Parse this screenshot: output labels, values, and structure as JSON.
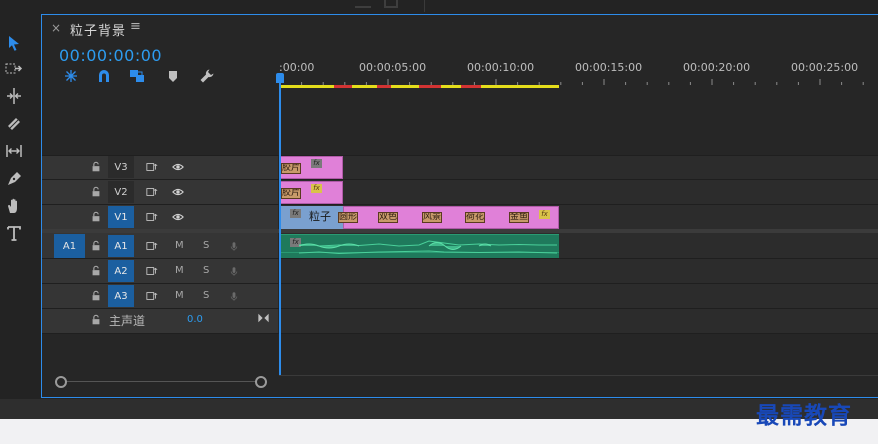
{
  "sequence": {
    "tab_close": "×",
    "title": "粒子背景",
    "menu_glyph": "≡",
    "timecode": "00:00:00:00"
  },
  "ruler": {
    "labels": [
      ":00:00",
      "00:00:05:00",
      "00:00:10:00",
      "00:00:15:00",
      "00:00:20:00",
      "00:00:25:00"
    ]
  },
  "tracks": {
    "video": [
      {
        "name": "V3",
        "target": false
      },
      {
        "name": "V2",
        "target": false
      },
      {
        "name": "V1",
        "target": true
      }
    ],
    "audio": [
      {
        "source": "A1",
        "name": "A1",
        "m": "M",
        "s": "S"
      },
      {
        "name": "A2",
        "m": "M",
        "s": "S"
      },
      {
        "name": "A3",
        "m": "M",
        "s": "S"
      }
    ],
    "master": {
      "name": "主声道",
      "value": "0.0"
    }
  },
  "clips": {
    "v3_thumb": "胶片",
    "v2_thumb": "胶片",
    "v1_label": "粒子",
    "v1_thumbs": [
      "圆形",
      "双色",
      "风景",
      "荷花",
      "金鱼"
    ],
    "fx": "fx"
  },
  "colors": {
    "accent": "#2d8ceb",
    "timecode": "#2d9cf0",
    "video_clip": "#e080d8",
    "audio_clip": "#1f7a5c",
    "work_area": "#e4dd1b",
    "render_red": "#d23333"
  },
  "watermark": "最需教育"
}
